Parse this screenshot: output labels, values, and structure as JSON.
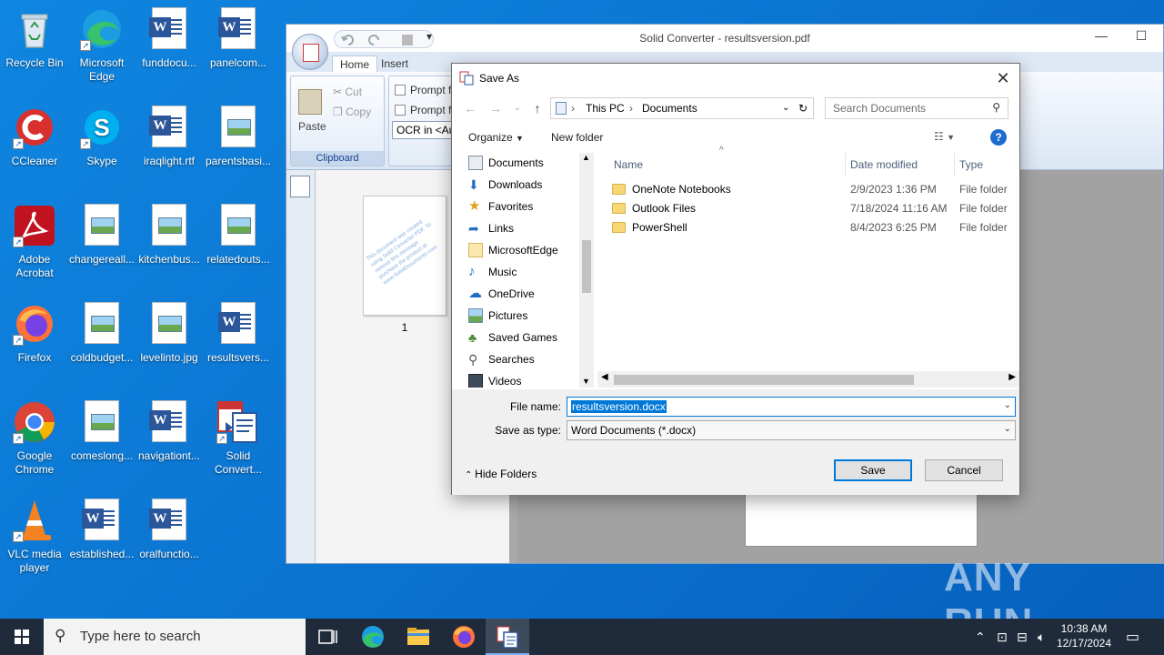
{
  "desktop": {
    "icons": [
      {
        "label": "Recycle Bin"
      },
      {
        "label": "Microsoft Edge"
      },
      {
        "label": "funddocu..."
      },
      {
        "label": "panelcom..."
      },
      {
        "label": "CCleaner"
      },
      {
        "label": "Skype"
      },
      {
        "label": "iraqlight.rtf"
      },
      {
        "label": "parentsbasi..."
      },
      {
        "label": "Adobe Acrobat"
      },
      {
        "label": "changereall..."
      },
      {
        "label": "kitchenbus..."
      },
      {
        "label": "relatedouts..."
      },
      {
        "label": "Firefox"
      },
      {
        "label": "coldbudget..."
      },
      {
        "label": "levelinto.jpg"
      },
      {
        "label": "resultsvers..."
      },
      {
        "label": "Google Chrome"
      },
      {
        "label": "comeslong..."
      },
      {
        "label": "navigationt..."
      },
      {
        "label": "Solid Convert..."
      },
      {
        "label": "VLC media player"
      },
      {
        "label": "established..."
      },
      {
        "label": "oralfunctio..."
      }
    ]
  },
  "app": {
    "title": "Solid Converter - resultsversion.pdf",
    "tabs": [
      "Home",
      "Insert"
    ],
    "clipboard": {
      "paste": "Paste",
      "cut": "Cut",
      "copy": "Copy",
      "group_label": "Clipboard"
    },
    "options": {
      "prompt1": "Prompt f",
      "prompt2": "Prompt f",
      "ocr": "OCR in <Au"
    },
    "page_number": "1",
    "watermark_text": "This document was created using Solid Converter PDF. To remove this message purchase the product at www.SolidDocuments.com"
  },
  "dialog": {
    "title": "Save As",
    "breadcrumb": [
      "This PC",
      "Documents"
    ],
    "search_placeholder": "Search Documents",
    "toolbar": {
      "organize": "Organize",
      "new_folder": "New folder"
    },
    "nav_items": [
      "Documents",
      "Downloads",
      "Favorites",
      "Links",
      "MicrosoftEdge",
      "Music",
      "OneDrive",
      "Pictures",
      "Saved Games",
      "Searches",
      "Videos"
    ],
    "columns": {
      "name": "Name",
      "date": "Date modified",
      "type": "Type"
    },
    "files": [
      {
        "name": "OneNote Notebooks",
        "date": "2/9/2023 1:36 PM",
        "type": "File folder"
      },
      {
        "name": "Outlook Files",
        "date": "7/18/2024 11:16 AM",
        "type": "File folder"
      },
      {
        "name": "PowerShell",
        "date": "8/4/2023 6:25 PM",
        "type": "File folder"
      }
    ],
    "file_name_label": "File name:",
    "file_name": "resultsversion.docx",
    "save_type_label": "Save as type:",
    "save_type": "Word Documents (*.docx)",
    "hide_folders": "Hide Folders",
    "save": "Save",
    "cancel": "Cancel"
  },
  "taskbar": {
    "search_placeholder": "Type here to search",
    "time": "10:38 AM",
    "date": "12/17/2024"
  },
  "watermark": "ANY RUN"
}
